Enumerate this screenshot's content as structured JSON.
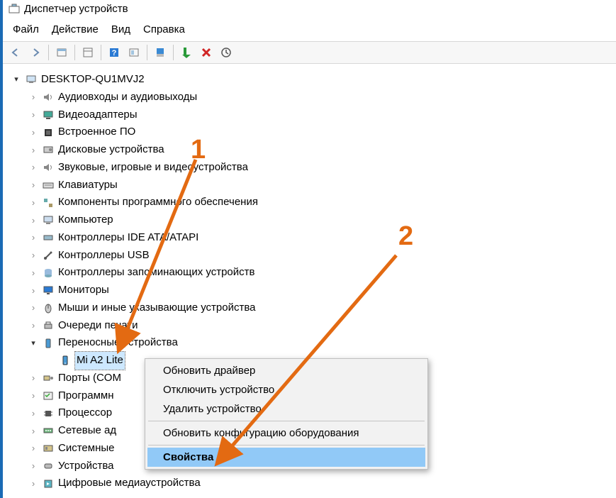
{
  "window": {
    "title": "Диспетчер устройств"
  },
  "menu": {
    "file": "Файл",
    "action": "Действие",
    "view": "Вид",
    "help": "Справка"
  },
  "root": {
    "label": "DESKTOP-QU1MVJ2"
  },
  "categories": [
    {
      "label": "Аудиовходы и аудиовыходы",
      "icon": "speaker"
    },
    {
      "label": "Видеоадаптеры",
      "icon": "display"
    },
    {
      "label": "Встроенное ПО",
      "icon": "chip"
    },
    {
      "label": "Дисковые устройства",
      "icon": "drive"
    },
    {
      "label": "Звуковые, игровые и видеоустройства",
      "icon": "speaker"
    },
    {
      "label": "Клавиатуры",
      "icon": "keyboard"
    },
    {
      "label": "Компоненты программного обеспечения",
      "icon": "component"
    },
    {
      "label": "Компьютер",
      "icon": "computer"
    },
    {
      "label": "Контроллеры IDE ATA/ATAPI",
      "icon": "controller"
    },
    {
      "label": "Контроллеры USB",
      "icon": "usb"
    },
    {
      "label": "Контроллеры запоминающих устройств",
      "icon": "storage"
    },
    {
      "label": "Мониторы",
      "icon": "monitor"
    },
    {
      "label": "Мыши и иные указывающие устройства",
      "icon": "mouse"
    },
    {
      "label": "Очереди печати",
      "icon": "printer"
    },
    {
      "label": "Переносные устройства",
      "icon": "portable",
      "expanded": true,
      "children": [
        {
          "label": "Mi A2 Lite",
          "icon": "phone",
          "selected": true
        }
      ]
    },
    {
      "label": "Порты (COM",
      "icon": "port",
      "truncated": true
    },
    {
      "label": "Программн",
      "icon": "software",
      "truncated": true
    },
    {
      "label": "Процессор",
      "icon": "cpu",
      "truncated": true
    },
    {
      "label": "Сетевые ад",
      "icon": "network",
      "truncated": true
    },
    {
      "label": "Системные",
      "icon": "system",
      "truncated": true
    },
    {
      "label": "Устройства",
      "icon": "hid",
      "truncated": true
    },
    {
      "label": "Цифровые медиаустройства",
      "icon": "media",
      "truncated": true
    }
  ],
  "context_menu": {
    "items": [
      {
        "label": "Обновить драйвер"
      },
      {
        "label": "Отключить устройство"
      },
      {
        "label": "Удалить устройство"
      }
    ],
    "items2": [
      {
        "label": "Обновить конфигурацию оборудования"
      }
    ],
    "items3": [
      {
        "label": "Свойства",
        "hover": true
      }
    ]
  },
  "annotations": {
    "one": "1",
    "two": "2"
  }
}
